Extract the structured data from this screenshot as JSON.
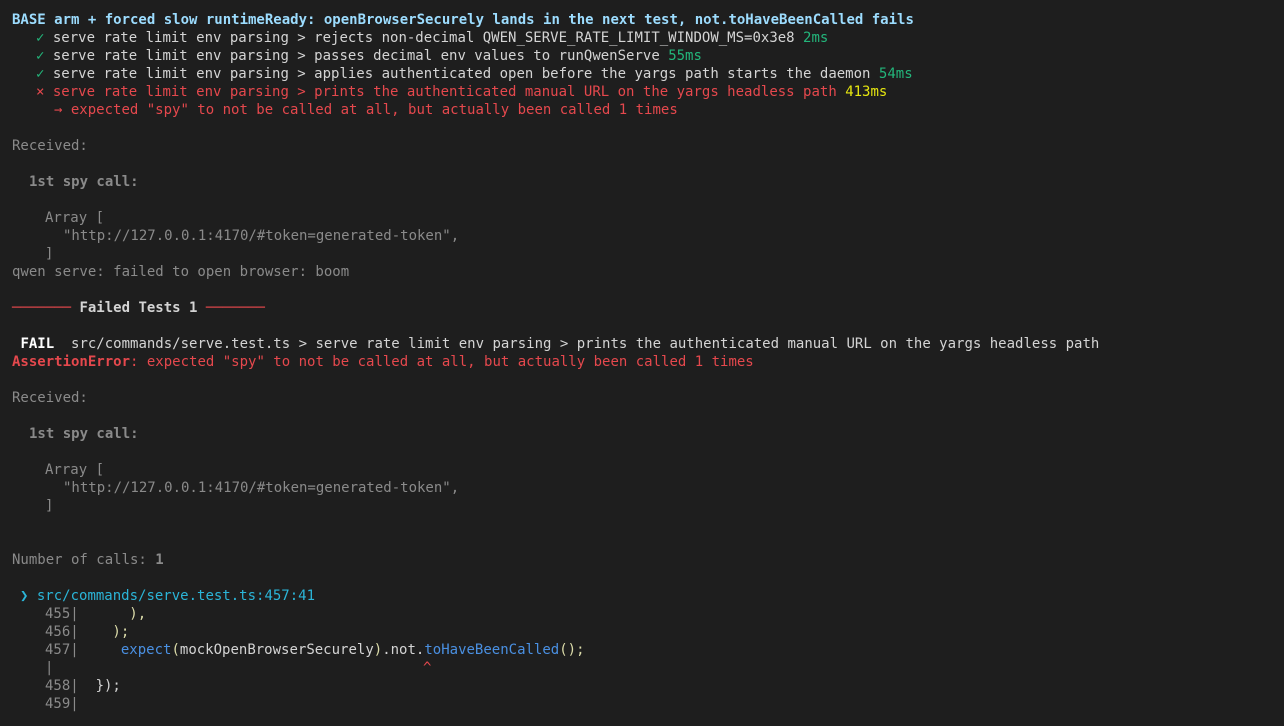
{
  "heading": "BASE arm + forced slow runtimeReady: openBrowserSecurely lands in the next test, not.toHaveBeenCalled fails",
  "results": [
    {
      "status": "pass",
      "icon": "✓",
      "text": "serve rate limit env parsing > rejects non-decimal QWEN_SERVE_RATE_LIMIT_WINDOW_MS=0x3e8",
      "duration": "2ms"
    },
    {
      "status": "pass",
      "icon": "✓",
      "text": "serve rate limit env parsing > passes decimal env values to runQwenServe",
      "duration": "55ms"
    },
    {
      "status": "pass",
      "icon": "✓",
      "text": "serve rate limit env parsing > applies authenticated open before the yargs path starts the daemon",
      "duration": "54ms"
    },
    {
      "status": "fail",
      "icon": "×",
      "text": "serve rate limit env parsing > prints the authenticated manual URL on the yargs headless path",
      "duration": "413ms"
    }
  ],
  "failure_arrow": "→",
  "failure_message": "expected \"spy\" to not be called at all, but actually been called 1 times",
  "received_label": "Received:",
  "spy_call_label": "1st spy call:",
  "array_open": "Array [",
  "array_item": "\"http://127.0.0.1:4170/#token=generated-token\",",
  "array_close": "]",
  "stderr_line": "qwen serve: failed to open browser: boom",
  "failed_tests": {
    "rule_left": "───────",
    "title": "Failed Tests 1",
    "rule_right": "───────"
  },
  "fail_block": {
    "badge": "FAIL",
    "path": "src/commands/serve.test.ts > serve rate limit env parsing > prints the authenticated manual URL on the yargs headless path",
    "error_name": "AssertionError",
    "error_message": ": expected \"spy\" to not be called at all, but actually been called 1 times"
  },
  "calls_label": "Number of calls: ",
  "calls_value": "1",
  "location": {
    "marker": "❯",
    "file": "src/commands/serve.test.ts:457:41"
  },
  "code": {
    "n455": "455|",
    "c455": "      ),",
    "n456": "456|",
    "c456": "    );",
    "n457": "457|",
    "c457_fn": "expect",
    "c457_open": "(",
    "c457_arg": "mockOpenBrowserSecurely",
    "c457_close": ")",
    "c457_not": ".not.",
    "c457_method": "toHaveBeenCalled",
    "c457_end": "();",
    "pipe": "|",
    "caret": "^",
    "n458": "458|",
    "c458": "  });",
    "n459": "459|"
  }
}
